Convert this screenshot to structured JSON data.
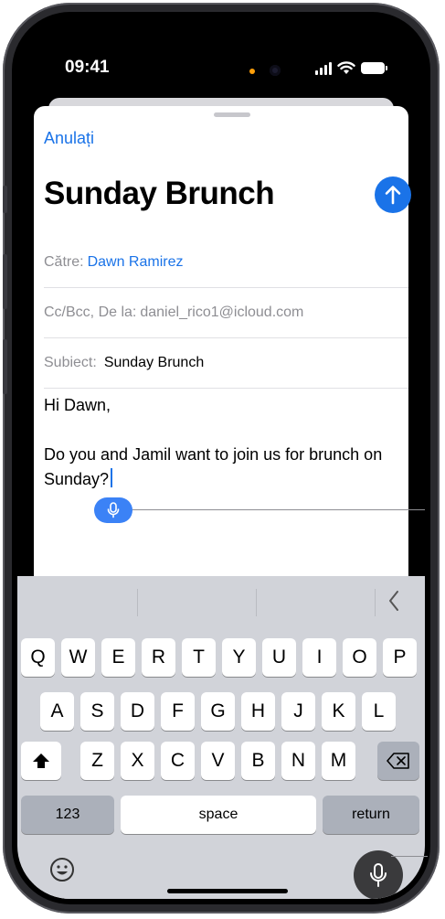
{
  "status_bar": {
    "time": "09:41"
  },
  "header": {
    "cancel_label": "Anulați",
    "title": "Sunday Brunch"
  },
  "fields": {
    "to": {
      "label": "Către:",
      "value": "Dawn Ramirez"
    },
    "cc": {
      "label": "Cc/Bcc, De la:",
      "value": "daniel_rico1@icloud.com"
    },
    "subject": {
      "label": "Subiect:",
      "value": "Sunday Brunch"
    }
  },
  "body": {
    "greeting": "Hi Dawn,",
    "line1": "Do you and Jamil want to join us for brunch on",
    "line2": "Sunday?"
  },
  "keyboard": {
    "row1": [
      "Q",
      "W",
      "E",
      "R",
      "T",
      "Y",
      "U",
      "I",
      "O",
      "P"
    ],
    "row2": [
      "A",
      "S",
      "D",
      "F",
      "G",
      "H",
      "J",
      "K",
      "L"
    ],
    "row3": [
      "Z",
      "X",
      "C",
      "V",
      "B",
      "N",
      "M"
    ],
    "numbers_label": "123",
    "space_label": "space",
    "return_label": "return"
  },
  "colors": {
    "accent": "#1a73e8",
    "keyboard_bg": "#d1d3d9"
  },
  "icons": [
    "send-arrow-icon",
    "dictation-mic-icon",
    "shift-icon",
    "delete-icon",
    "emoji-icon",
    "collapse-chevron-icon"
  ]
}
